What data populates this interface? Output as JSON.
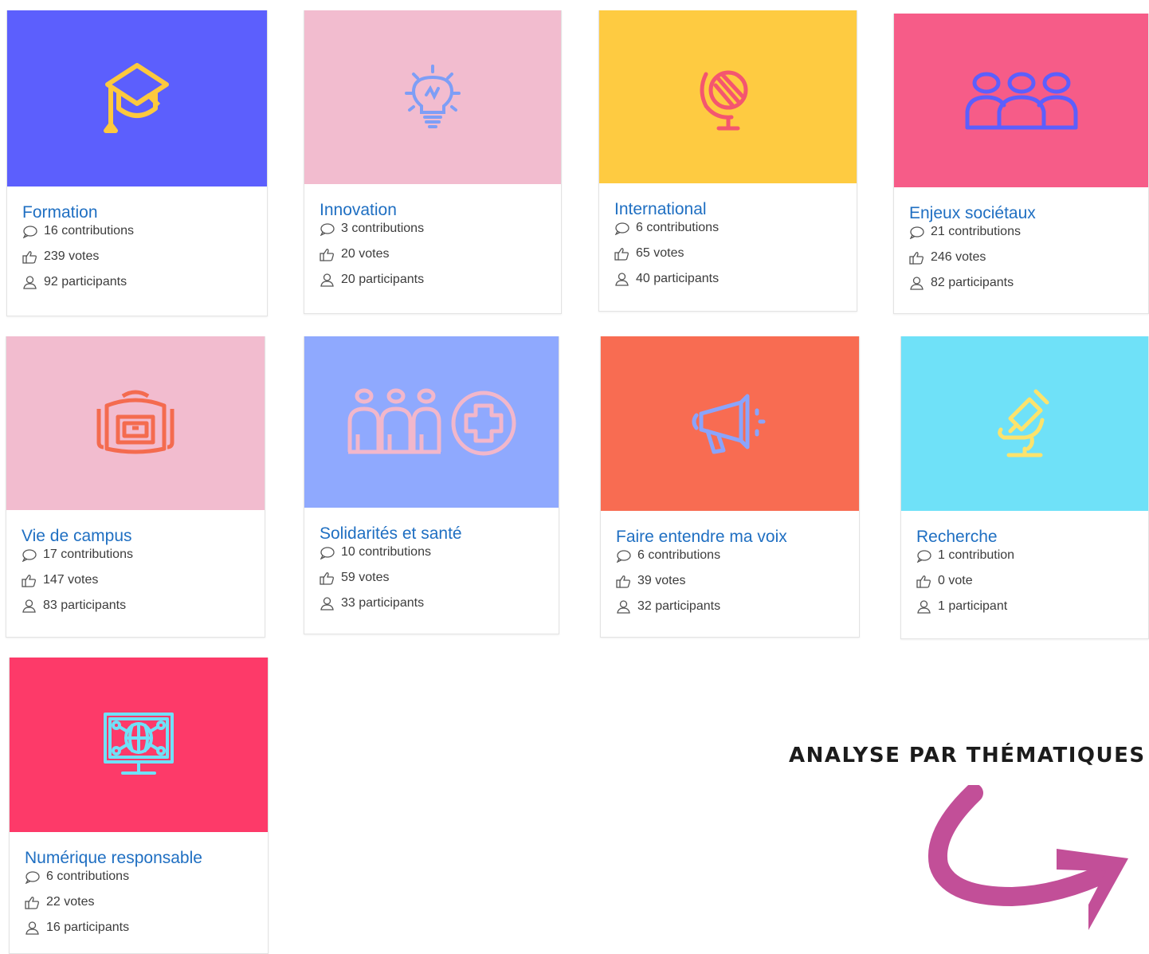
{
  "section_title": "ANALYSE PAR THÉMATIQUES",
  "colors": {
    "title_link": "#1f6fc2",
    "stat_text": "#3c3c3c",
    "arrow": "#c24f98"
  },
  "themes": [
    {
      "title": "Formation",
      "contributions": "16 contributions",
      "votes": "239 votes",
      "participants": "92 participants",
      "banner_color": "#5c5ffd",
      "icon_color": "#fdc93d",
      "icon": "graduation-cap-icon"
    },
    {
      "title": "Innovation",
      "contributions": "3 contributions",
      "votes": "20 votes",
      "participants": "20 participants",
      "banner_color": "#f2bccf",
      "icon_color": "#7e9ef6",
      "icon": "lightbulb-icon"
    },
    {
      "title": "International",
      "contributions": "6 contributions",
      "votes": "65 votes",
      "participants": "40 participants",
      "banner_color": "#fecb41",
      "icon_color": "#f4566f",
      "icon": "globe-icon"
    },
    {
      "title": "Enjeux sociétaux",
      "contributions": "21 contributions",
      "votes": "246 votes",
      "participants": "82 participants",
      "banner_color": "#f65c88",
      "icon_color": "#5c5ffd",
      "icon": "people-group-icon"
    },
    {
      "title": "Vie de campus",
      "contributions": "17 contributions",
      "votes": "147 votes",
      "participants": "83 participants",
      "banner_color": "#f2bccf",
      "icon_color": "#f46b4f",
      "icon": "campus-backpack-icon"
    },
    {
      "title": "Solidarités et santé",
      "contributions": "10 contributions",
      "votes": "59 votes",
      "participants": "33 participants",
      "banner_color": "#8fa9fe",
      "icon_color": "#f2b7cb",
      "icon": "health-solidarity-icon"
    },
    {
      "title": "Faire entendre ma voix",
      "contributions": "6 contributions",
      "votes": "39 votes",
      "participants": "32 participants",
      "banner_color": "#f86c52",
      "icon_color": "#8aa4fc",
      "icon": "megaphone-icon"
    },
    {
      "title": "Recherche",
      "contributions": "1 contribution",
      "votes": "0 vote",
      "participants": "1 participant",
      "banner_color": "#6fe1f8",
      "icon_color": "#fce36c",
      "icon": "microscope-icon"
    },
    {
      "title": "Numérique responsable",
      "contributions": "6 contributions",
      "votes": "22 votes",
      "participants": "16 participants",
      "banner_color": "#fd3a69",
      "icon_color": "#6fe1f8",
      "icon": "digital-monitor-icon"
    }
  ]
}
